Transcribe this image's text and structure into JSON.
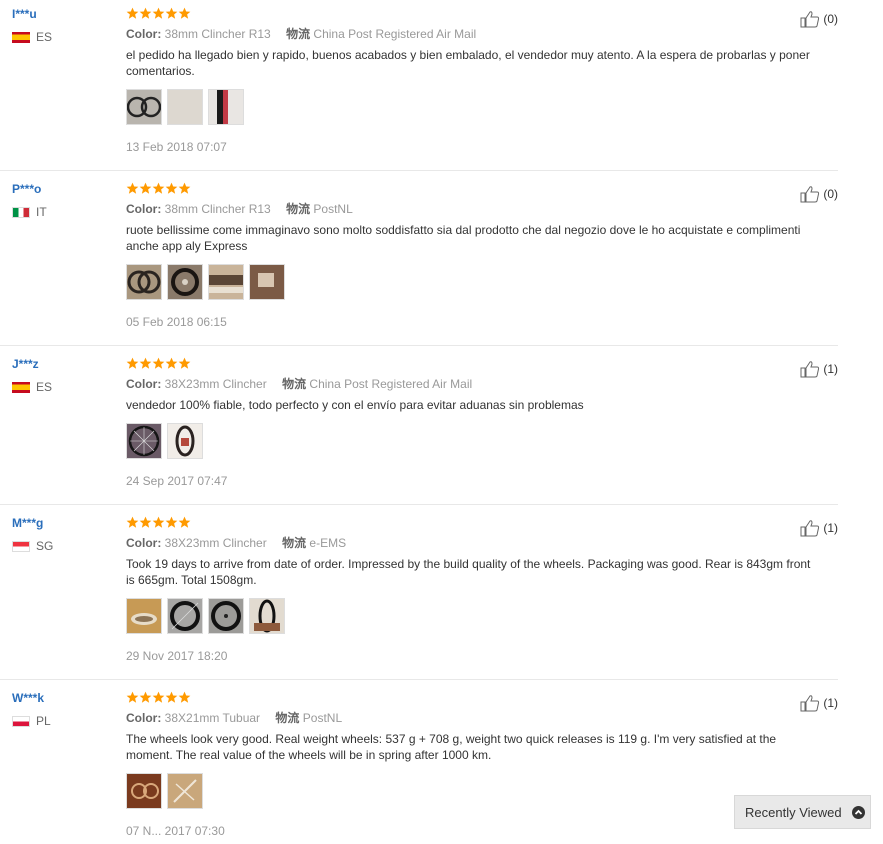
{
  "colors": {
    "star": "#ff9a00",
    "username": "#2a6ebb",
    "muted": "#999999"
  },
  "labels": {
    "color_label": "Color:",
    "logistics_label": "物流"
  },
  "reviews": [
    {
      "user": "I***u",
      "country": "ES",
      "flag": "es",
      "stars": 5,
      "color": "38mm Clincher R13",
      "logistics": "China Post Registered Air Mail",
      "text": "el pedido ha llegado bien y rapido, buenos acabados y bien embalado, el vendedor muy atento. A la espera de probarlas y poner comentarios.",
      "photos": [
        "wheel-pair",
        "tire-closeup",
        "rim-red"
      ],
      "date": "13 Feb 2018 07:07",
      "likes": "(0)"
    },
    {
      "user": "P***o",
      "country": "IT",
      "flag": "it",
      "stars": 5,
      "color": "38mm Clincher R13",
      "logistics": "PostNL",
      "text": "ruote bellissime come immaginavo sono molto soddisfatto sia dal prodotto che dal negozio dove le ho acquistate e complimenti anche app aly Express",
      "photos": [
        "wheels-1",
        "wheels-2",
        "package-1",
        "package-2"
      ],
      "date": "05 Feb 2018 06:15",
      "likes": "(0)"
    },
    {
      "user": "J***z",
      "country": "ES",
      "flag": "es",
      "stars": 5,
      "color": "38X23mm Clincher",
      "logistics": "China Post Registered Air Mail",
      "text": "vendedor 100% fiable, todo perfecto y con el envío para evitar aduanas sin problemas",
      "photos": [
        "wheel-spokes",
        "wheel-small"
      ],
      "date": "24 Sep 2017 07:47",
      "likes": "(1)"
    },
    {
      "user": "M***g",
      "country": "SG",
      "flag": "sg",
      "stars": 5,
      "color": "38X23mm Clincher",
      "logistics": "e-EMS",
      "text": "Took 19 days to arrive from date of order. Impressed by the build quality of the wheels. Packaging was good. Rear is 843gm front is 665gm. Total 1508gm.",
      "photos": [
        "scale-1",
        "wheel-dark-1",
        "wheel-dark-2",
        "wheel-scale"
      ],
      "date": "29 Nov 2017 18:20",
      "likes": "(1)"
    },
    {
      "user": "W***k",
      "country": "PL",
      "flag": "pl",
      "stars": 5,
      "color": "38X21mm Tubuar",
      "logistics": "PostNL",
      "text": "The wheels look very good. Real weight wheels: 537 g + 708 g, weight two quick releases is 119 g. I'm very satisfied at the moment. The real value of the wheels will be in spring after 1000 km.",
      "photos": [
        "hub-brown",
        "quick-release"
      ],
      "date": "07 N... 2017 07:30",
      "likes": "(1)"
    }
  ],
  "recently_viewed": {
    "label": "Recently Viewed",
    "icon": "chevron-up-icon"
  }
}
